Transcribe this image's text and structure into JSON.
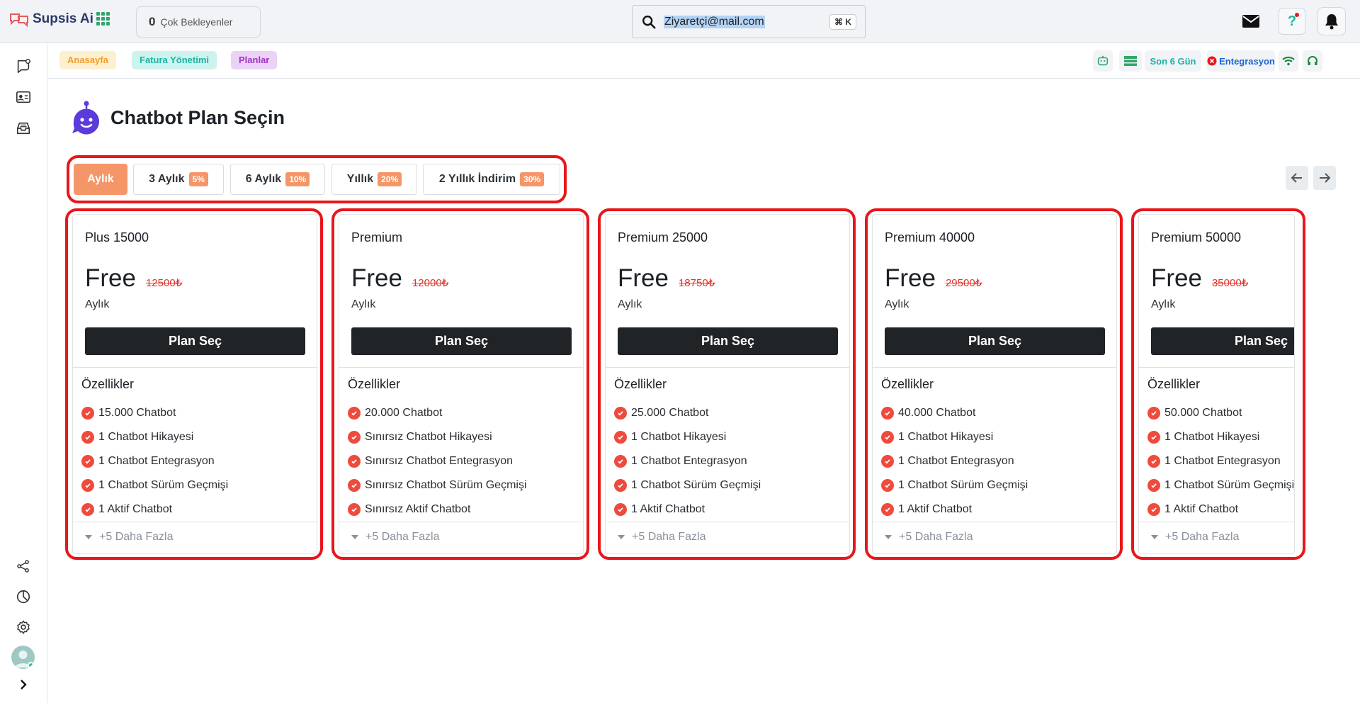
{
  "app": {
    "name": "Supsis Ai"
  },
  "topbar": {
    "pending_count": "0",
    "pending_label": "Çok Bekleyenler",
    "search_value": "Ziyaretçi@mail.com",
    "search_shortcut": "⌘ K",
    "help_label": "?"
  },
  "breadcrumbs": [
    "Anasayfa",
    "Fatura Yönetimi",
    "Planlar"
  ],
  "status": {
    "period_label": "Son 6 Gün",
    "integration_label": "Entegrasyon"
  },
  "page": {
    "title": "Chatbot Plan Seçin"
  },
  "tabs": [
    {
      "label": "Aylık",
      "discount": "",
      "active": true
    },
    {
      "label": "3 Aylık",
      "discount": "5%"
    },
    {
      "label": "6 Aylık",
      "discount": "10%"
    },
    {
      "label": "Yıllık",
      "discount": "20%"
    },
    {
      "label": "2 Yıllık İndirim",
      "discount": "30%"
    }
  ],
  "plans": [
    {
      "name": "Plus 15000",
      "price": "Free",
      "old_price": "12500₺",
      "period": "Aylık",
      "button": "Plan Seç",
      "features_title": "Özellikler",
      "features": [
        "15.000 Chatbot",
        "1 Chatbot Hikayesi",
        "1 Chatbot Entegrasyon",
        "1 Chatbot Sürüm Geçmişi",
        "1 Aktif Chatbot"
      ],
      "more": "+5 Daha Fazla"
    },
    {
      "name": "Premium",
      "price": "Free",
      "old_price": "12000₺",
      "period": "Aylık",
      "button": "Plan Seç",
      "features_title": "Özellikler",
      "features": [
        "20.000 Chatbot",
        "Sınırsız Chatbot Hikayesi",
        "Sınırsız Chatbot Entegrasyon",
        "Sınırsız Chatbot Sürüm Geçmişi",
        "Sınırsız Aktif Chatbot"
      ],
      "more": "+5 Daha Fazla"
    },
    {
      "name": "Premium 25000",
      "price": "Free",
      "old_price": "18750₺",
      "period": "Aylık",
      "button": "Plan Seç",
      "features_title": "Özellikler",
      "features": [
        "25.000 Chatbot",
        "1 Chatbot Hikayesi",
        "1 Chatbot Entegrasyon",
        "1 Chatbot Sürüm Geçmişi",
        "1 Aktif Chatbot"
      ],
      "more": "+5 Daha Fazla"
    },
    {
      "name": "Premium 40000",
      "price": "Free",
      "old_price": "29500₺",
      "period": "Aylık",
      "button": "Plan Seç",
      "features_title": "Özellikler",
      "features": [
        "40.000 Chatbot",
        "1 Chatbot Hikayesi",
        "1 Chatbot Entegrasyon",
        "1 Chatbot Sürüm Geçmişi",
        "1 Aktif Chatbot"
      ],
      "more": "+5 Daha Fazla"
    },
    {
      "name": "Premium 50000",
      "price": "Free",
      "old_price": "35000₺",
      "period": "Aylık",
      "button": "Plan Seç",
      "features_title": "Özellikler",
      "features": [
        "50.000 Chatbot",
        "1 Chatbot Hikayesi",
        "1 Chatbot Entegrasyon",
        "1 Chatbot Sürüm Geçmişi",
        "1 Aktif Chatbot"
      ],
      "more": "+5 Daha Fazla"
    }
  ],
  "icons": {
    "apps": "apps-grid-icon",
    "search": "search-icon",
    "mail": "mail-icon",
    "help": "help-icon",
    "bell": "bell-icon",
    "sidebar_top": [
      "chat-icon",
      "contact-card-icon",
      "inbox-icon"
    ],
    "sidebar_bottom": [
      "share-icon",
      "pie-chart-icon",
      "gear-icon"
    ],
    "bot": "chatbot-icon",
    "check": "check-circle-icon"
  },
  "colors": {
    "accent": "#f59668",
    "highlight": "#e8161b",
    "button": "#202427",
    "strike": "#e0352b"
  }
}
